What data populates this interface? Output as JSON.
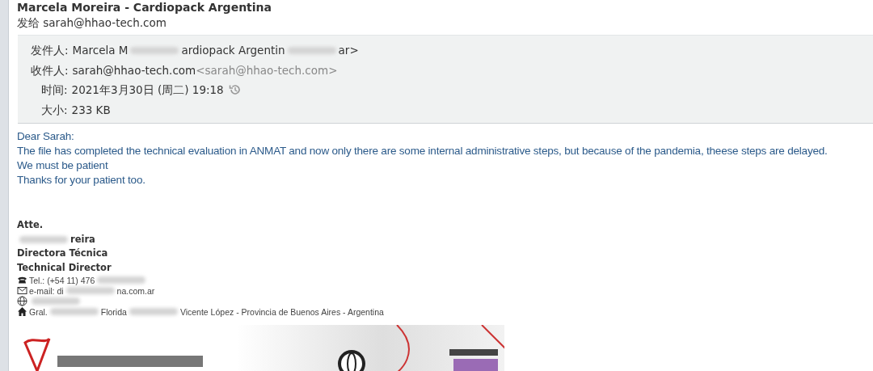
{
  "message": {
    "subject": "Marcela Moreira - Cardiopack Argentina",
    "sent_to": "发给 sarah@hhao-tech.com"
  },
  "header": {
    "fields": [
      {
        "label": "发件人:",
        "parts": [
          {
            "kind": "text",
            "text": "Marcela M"
          },
          {
            "kind": "redacted"
          },
          {
            "kind": "text",
            "text": "ardiopack Argentin"
          },
          {
            "kind": "redacted"
          },
          {
            "kind": "text",
            "text": "ar>"
          }
        ]
      },
      {
        "label": "收件人:",
        "parts": [
          {
            "kind": "text",
            "text": "sarah@hhao-tech.com"
          },
          {
            "kind": "muted",
            "text": "<sarah@hhao-tech.com>"
          }
        ]
      },
      {
        "label": "时间:",
        "parts": [
          {
            "kind": "text",
            "text": "2021年3月30日 (周二) 19:18"
          },
          {
            "kind": "history"
          }
        ]
      },
      {
        "label": "大小:",
        "parts": [
          {
            "kind": "text",
            "text": "233 KB"
          }
        ]
      }
    ]
  },
  "body": {
    "paragraphs": [
      "Dear Sarah:",
      "The file has completed the technical evaluation in ANMAT and now only there are some internal administrative steps, but because of the pandemia, theese steps are delayed.",
      "We must be patient",
      "Thanks for your patient too."
    ]
  },
  "signature": {
    "lines": [
      {
        "kind": "bold",
        "parts": [
          {
            "kind": "text",
            "text": "Atte."
          }
        ]
      },
      {
        "kind": "bold",
        "parts": [
          {
            "kind": "redacted"
          },
          {
            "kind": "text",
            "text": "reira"
          }
        ]
      },
      {
        "kind": "bold",
        "parts": [
          {
            "kind": "text",
            "text": "Directora Técnica"
          }
        ]
      },
      {
        "kind": "bold",
        "parts": [
          {
            "kind": "text",
            "text": "Technical Director"
          }
        ]
      },
      {
        "kind": "phone",
        "parts": [
          {
            "kind": "text",
            "text": "Tel.: (+54 11) 476"
          },
          {
            "kind": "redacted"
          }
        ]
      },
      {
        "kind": "mail",
        "parts": [
          {
            "kind": "text",
            "text": "e-mail: di"
          },
          {
            "kind": "redacted"
          },
          {
            "kind": "text",
            "text": "na.com.ar"
          }
        ]
      },
      {
        "kind": "web",
        "parts": [
          {
            "kind": "redacted"
          }
        ]
      },
      {
        "kind": "home",
        "parts": [
          {
            "kind": "text",
            "text": "Gral."
          },
          {
            "kind": "redacted"
          },
          {
            "kind": "text",
            "text": "Florida"
          },
          {
            "kind": "redacted"
          },
          {
            "kind": "text",
            "text": "Vicente López - Provincia de Buenos Aires - Argentina"
          }
        ]
      }
    ]
  }
}
